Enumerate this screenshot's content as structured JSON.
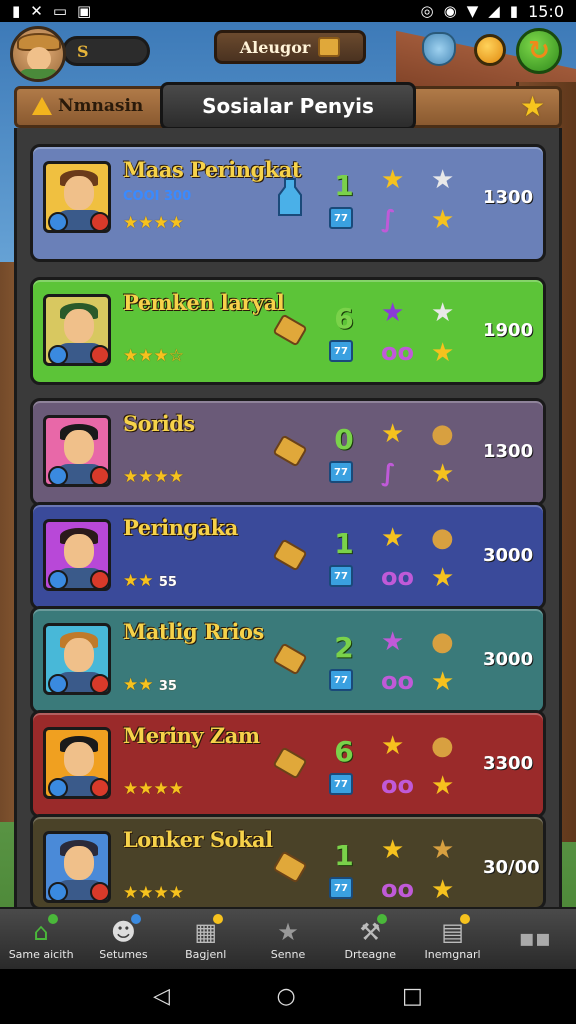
{
  "status_bar": {
    "time": "15:0"
  },
  "hud": {
    "resource_label": "S",
    "center_label": "Aleugor"
  },
  "header": {
    "tab_label": "Nmnasin",
    "title": "Sosialar Penyis"
  },
  "rows": [
    {
      "name": "Maas Peringkat",
      "subcode": "COOI 300",
      "stars": "★★★★",
      "star_text": "",
      "num": "1",
      "score": "1300",
      "bg": "#6a80b8"
    },
    {
      "name": "Pemken laryal",
      "subcode": "",
      "stars": "★★★☆",
      "star_text": "",
      "num": "6",
      "score": "1900",
      "bg": "#5cc438"
    },
    {
      "name": "Sorids",
      "subcode": "",
      "stars": "★★★★",
      "star_text": "",
      "num": "0",
      "score": "1300",
      "bg": "#6a5a78"
    },
    {
      "name": "Peringaka",
      "subcode": "",
      "stars": "★★",
      "star_text": "55",
      "num": "1",
      "score": "3000",
      "bg": "#3a4a9a"
    },
    {
      "name": "Matlig Rrios",
      "subcode": "",
      "stars": "★★",
      "star_text": "35",
      "num": "2",
      "score": "3000",
      "bg": "#3a7a7a"
    },
    {
      "name": "Meriny Zam",
      "subcode": "",
      "stars": "★★★★",
      "star_text": "",
      "num": "6",
      "score": "3300",
      "bg": "#9a2a2a"
    },
    {
      "name": "Lonker Sokal",
      "subcode": "",
      "stars": "★★★★",
      "star_text": "",
      "num": "1",
      "score": "30/00",
      "bg": "#4a4228"
    }
  ],
  "nav": [
    {
      "label": "Same aicith",
      "icon": "home-icon"
    },
    {
      "label": "Setumes",
      "icon": "skull-icon"
    },
    {
      "label": "Bagjenl",
      "icon": "dice-icon"
    },
    {
      "label": "Senne",
      "icon": "star-icon"
    },
    {
      "label": "Drteagne",
      "icon": "hammer-icon"
    },
    {
      "label": "Inemgnarl",
      "icon": "grid-icon"
    },
    {
      "label": "",
      "icon": "menu-icon"
    }
  ],
  "colors": {
    "gold": "#f6c21e",
    "name_text": "#f6d24a",
    "green_num": "#7ad24a"
  }
}
